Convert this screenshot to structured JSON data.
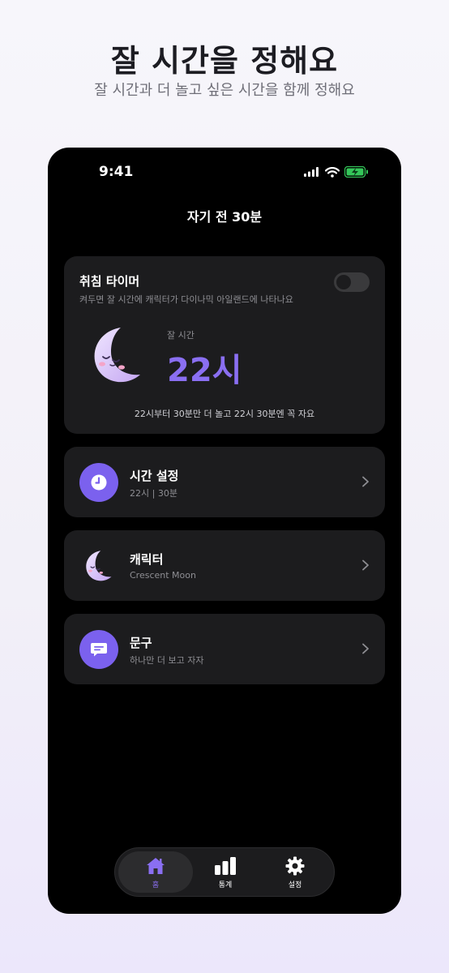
{
  "hero": {
    "title": "잘 시간을 정해요",
    "subtitle": "잘 시간과 더 놀고 싶은 시간을 함께 정해요"
  },
  "status_bar": {
    "time": "9:41",
    "icons": [
      "signal-icon",
      "wifi-icon",
      "battery-charging-icon"
    ]
  },
  "screen": {
    "title": "자기 전 30분"
  },
  "timer_card": {
    "title": "취침 타이머",
    "description": "켜두면 잘 시간에 캐릭터가 다이나믹 아일랜드에 나타나요",
    "toggle_on": false,
    "sleep_label": "잘 시간",
    "sleep_value": "22시",
    "footer": "22시부터 30분만 더 놀고 22시 30분엔 꼭 자요"
  },
  "menu": [
    {
      "title": "시간 설정",
      "subtitle": "22시 | 30분",
      "icon": "clock-icon"
    },
    {
      "title": "캐릭터",
      "subtitle": "Crescent Moon",
      "icon": "moon-icon"
    },
    {
      "title": "문구",
      "subtitle": "하나만 더 보고 자자",
      "icon": "message-icon"
    }
  ],
  "tabbar": {
    "items": [
      {
        "label": "홈",
        "icon": "home-icon",
        "active": true
      },
      {
        "label": "통계",
        "icon": "bar-chart-icon",
        "active": false
      },
      {
        "label": "설정",
        "icon": "gear-icon",
        "active": false
      }
    ]
  },
  "colors": {
    "accent": "#7b61ee",
    "accent_text": "#8a6ff2",
    "card": "#1c1c1e",
    "screen_bg": "#000000"
  }
}
